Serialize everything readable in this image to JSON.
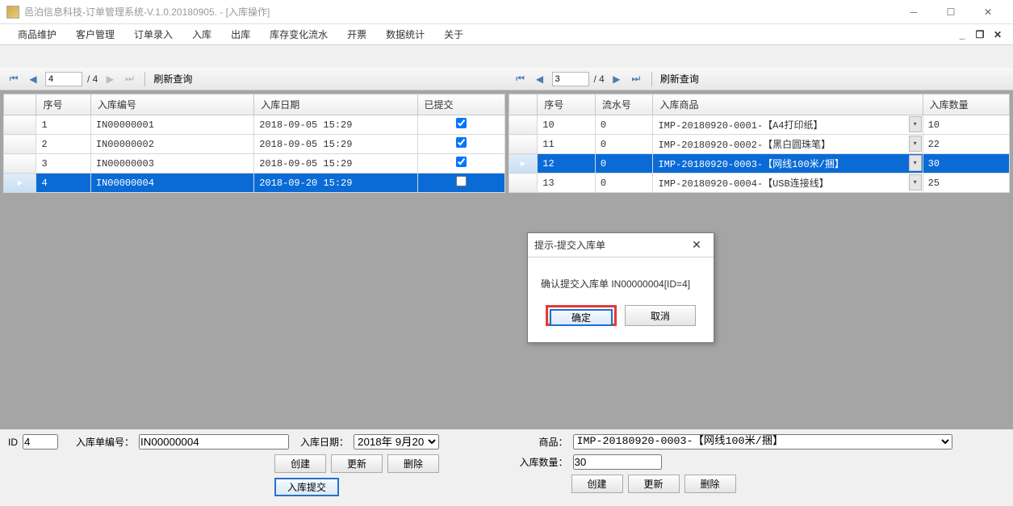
{
  "window": {
    "title": "邑泊信息科技-订单管理系统-V.1.0.20180905. - [入库操作]"
  },
  "menu": {
    "items": [
      "商品维护",
      "客户管理",
      "订单录入",
      "入库",
      "出库",
      "库存变化流水",
      "开票",
      "数据统计",
      "关于"
    ]
  },
  "nav_left": {
    "current": "4",
    "total": "/ 4",
    "refresh": "刷新查询"
  },
  "nav_right": {
    "current": "3",
    "total": "/ 4",
    "refresh": "刷新查询"
  },
  "left_grid": {
    "headers": [
      "序号",
      "入库编号",
      "入库日期",
      "已提交"
    ],
    "rows": [
      {
        "seq": "1",
        "code": "IN00000001",
        "date": "2018-09-05 15:29",
        "submitted": true,
        "selected": false
      },
      {
        "seq": "2",
        "code": "IN00000002",
        "date": "2018-09-05 15:29",
        "submitted": true,
        "selected": false
      },
      {
        "seq": "3",
        "code": "IN00000003",
        "date": "2018-09-05 15:29",
        "submitted": true,
        "selected": false
      },
      {
        "seq": "4",
        "code": "IN00000004",
        "date": "2018-09-20 15:29",
        "submitted": false,
        "selected": true
      }
    ]
  },
  "right_grid": {
    "headers": [
      "序号",
      "流水号",
      "入库商品",
      "入库数量"
    ],
    "rows": [
      {
        "seq": "10",
        "flow": "0",
        "product": "IMP-20180920-0001-【A4打印纸】",
        "qty": "10",
        "selected": false
      },
      {
        "seq": "11",
        "flow": "0",
        "product": "IMP-20180920-0002-【黑白圆珠笔】",
        "qty": "22",
        "selected": false
      },
      {
        "seq": "12",
        "flow": "0",
        "product": "IMP-20180920-0003-【网线100米/捆】",
        "qty": "30",
        "selected": true
      },
      {
        "seq": "13",
        "flow": "0",
        "product": "IMP-20180920-0004-【USB连接线】",
        "qty": "25",
        "selected": false
      }
    ]
  },
  "left_form": {
    "id_label": "ID",
    "id_value": "4",
    "code_label": "入库单编号：",
    "code_value": "IN00000004",
    "date_label": "入库日期：",
    "date_value": "2018年 9月20日",
    "btn_create": "创建",
    "btn_update": "更新",
    "btn_delete": "删除",
    "btn_submit": "入库提交"
  },
  "right_form": {
    "product_label": "商品：",
    "product_value": "IMP-20180920-0003-【网线100米/捆】",
    "qty_label": "入库数量：",
    "qty_value": "30",
    "btn_create": "创建",
    "btn_update": "更新",
    "btn_delete": "删除"
  },
  "dialog": {
    "title": "提示-提交入库单",
    "message": "确认提交入库单 IN00000004[ID=4]",
    "ok": "确定",
    "cancel": "取消"
  }
}
